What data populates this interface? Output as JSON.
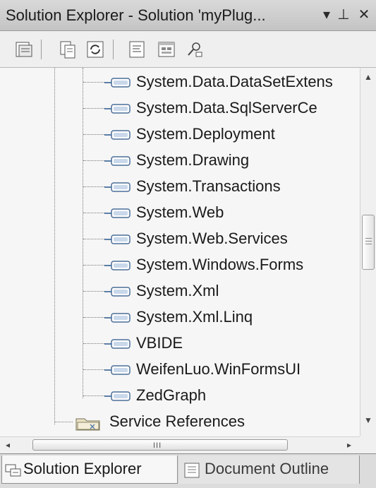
{
  "window": {
    "title": "Solution Explorer - Solution 'myPlug...",
    "pin_glyph": "▾",
    "autohide_glyph": "⊥",
    "close_glyph": "✕"
  },
  "toolbar": {
    "buttons": [
      "properties-icon",
      "show-all-files-icon",
      "refresh-icon",
      "view-code-icon",
      "view-designer-icon",
      "class-diagram-icon"
    ]
  },
  "tree": {
    "references": [
      "System.Data.DataSetExtens",
      "System.Data.SqlServerCe",
      "System.Deployment",
      "System.Drawing",
      "System.Transactions",
      "System.Web",
      "System.Web.Services",
      "System.Windows.Forms",
      "System.Xml",
      "System.Xml.Linq",
      "VBIDE",
      "WeifenLuo.WinFormsUI",
      "ZedGraph"
    ],
    "folder": "Service References"
  },
  "scrollbars": {
    "vertical_up": "▲",
    "vertical_down": "▼",
    "horizontal_left": "◂",
    "horizontal_right": "▸",
    "horizontal_grip": "III"
  },
  "tabs": {
    "active": "Solution Explorer",
    "inactive": "Document Outline"
  },
  "colors": {
    "panel_bg": "#f6f6f6",
    "titlebar": "#cfcfcf",
    "reference_icon": "#5b7fa8"
  }
}
